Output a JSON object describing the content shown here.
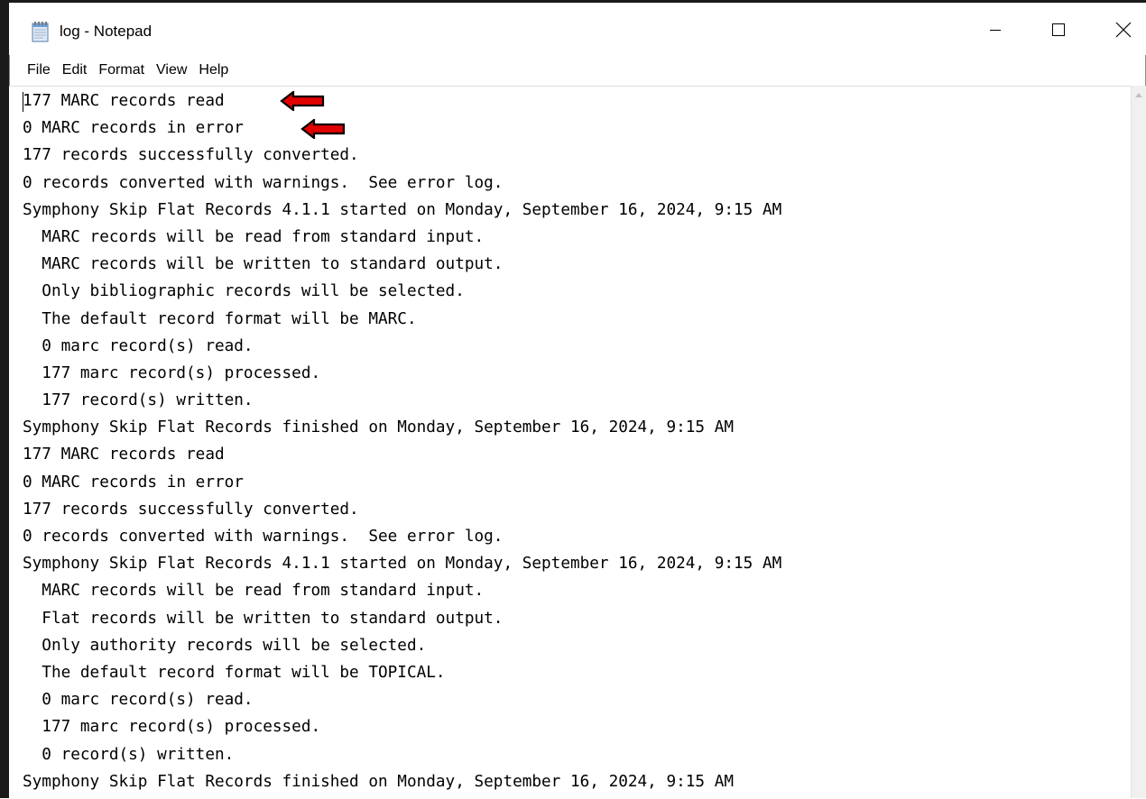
{
  "window": {
    "title": "log - Notepad",
    "icon": "notepad-icon",
    "controls": {
      "minimize_icon": "minimize-icon",
      "maximize_icon": "maximize-icon",
      "close_icon": "close-icon"
    }
  },
  "menu": {
    "items": [
      "File",
      "Edit",
      "Format",
      "View",
      "Help"
    ]
  },
  "editor": {
    "lines": [
      "177 MARC records read",
      "0 MARC records in error",
      "177 records successfully converted.",
      "0 records converted with warnings.  See error log.",
      "Symphony Skip Flat Records 4.1.1 started on Monday, September 16, 2024, 9:15 AM",
      "  MARC records will be read from standard input.",
      "  MARC records will be written to standard output.",
      "  Only bibliographic records will be selected.",
      "  The default record format will be MARC.",
      "  0 marc record(s) read.",
      "  177 marc record(s) processed.",
      "  177 record(s) written.",
      "Symphony Skip Flat Records finished on Monday, September 16, 2024, 9:15 AM",
      "177 MARC records read",
      "0 MARC records in error",
      "177 records successfully converted.",
      "0 records converted with warnings.  See error log.",
      "Symphony Skip Flat Records 4.1.1 started on Monday, September 16, 2024, 9:15 AM",
      "  MARC records will be read from standard input.",
      "  Flat records will be written to standard output.",
      "  Only authority records will be selected.",
      "  The default record format will be TOPICAL.",
      "  0 marc record(s) read.",
      "  177 marc record(s) processed.",
      "  0 record(s) written.",
      "Symphony Skip Flat Records finished on Monday, September 16, 2024, 9:15 AM"
    ]
  },
  "annotations": {
    "arrow_color": "#e00000",
    "arrow_outline": "#000000",
    "arrow_icon": "left-arrow-icon"
  }
}
